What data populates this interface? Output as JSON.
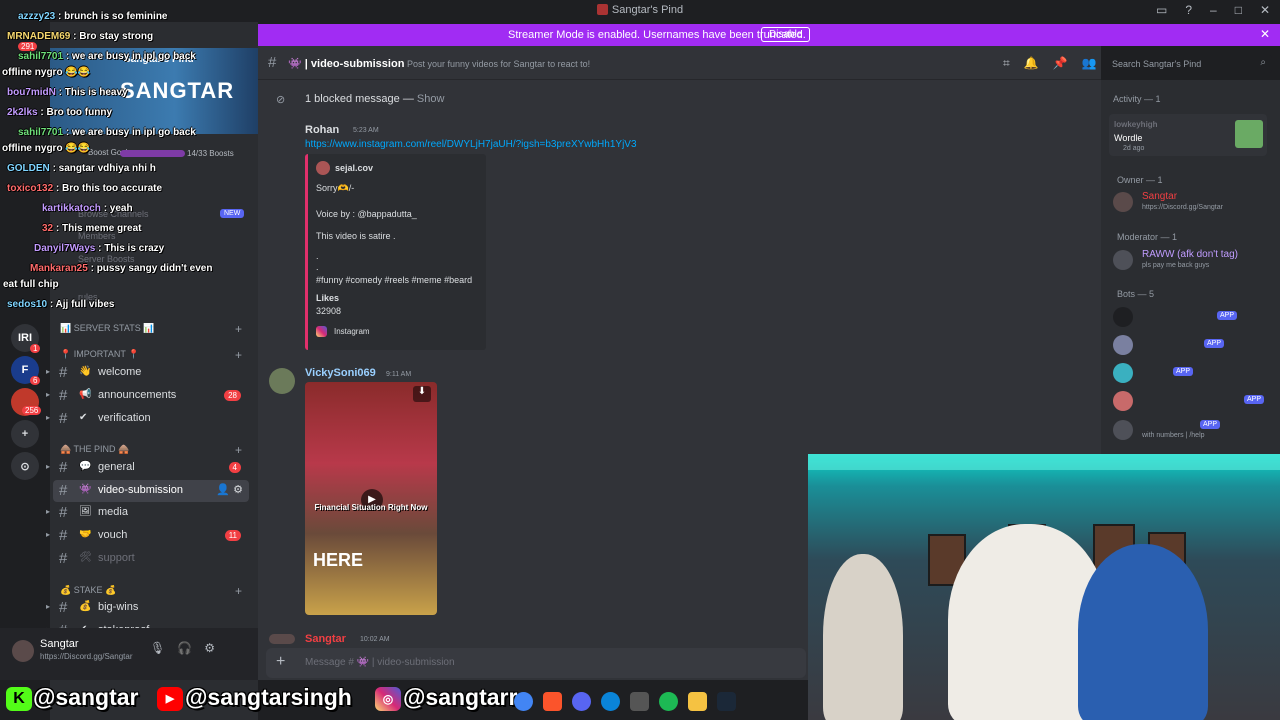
{
  "window": {
    "title": "Sangtar's Pind"
  },
  "banner": {
    "text": "Streamer Mode is enabled. Usernames have been truncated.",
    "button": "Disable"
  },
  "rail": {
    "items": [
      {
        "label": "IRI",
        "badge": "1"
      },
      {
        "label": "F",
        "badge": "6"
      },
      {
        "label": "",
        "badge": "256"
      },
      {
        "label": "+",
        "badge": ""
      },
      {
        "label": "⊙",
        "badge": ""
      }
    ],
    "top_badge": "291"
  },
  "server": {
    "name": "Sangtar's Pind",
    "banner_text": "SANGTAR",
    "boost_label": "Boost Goal",
    "boost_count": "14/33 Boosts",
    "dim_items": [
      "Browse Channels",
      "Members",
      "Server Boosts",
      "rules"
    ],
    "new_badge": "NEW"
  },
  "categories": [
    {
      "label": "📊 SERVER STATS 📊"
    },
    {
      "label": "📍 IMPORTANT 📍"
    },
    {
      "label": "🛖 The Pind 🛖"
    },
    {
      "label": "💰 Stake 💰"
    }
  ],
  "channels": [
    {
      "emoji": "👋",
      "name": "welcome",
      "count": ""
    },
    {
      "emoji": "📢",
      "name": "announcements",
      "count": "28"
    },
    {
      "emoji": "✔",
      "name": "verification",
      "count": ""
    },
    {
      "emoji": "💬",
      "name": "general",
      "count": "4"
    },
    {
      "emoji": "👾",
      "name": "video-submission",
      "count": ""
    },
    {
      "emoji": "🖼",
      "name": "media",
      "count": ""
    },
    {
      "emoji": "🤝",
      "name": "vouch",
      "count": "11"
    },
    {
      "emoji": "🛠",
      "name": "support",
      "count": ""
    },
    {
      "emoji": "💰",
      "name": "big-wins",
      "count": ""
    },
    {
      "emoji": "✔",
      "name": "stakeproof",
      "count": ""
    }
  ],
  "user": {
    "name": "Sangtar",
    "status": "https://Discord.gg/Sangtar"
  },
  "overlay_chat": [
    {
      "user": "azzzy23",
      "text": ": brunch is so feminine"
    },
    {
      "user": "MRNADEM69",
      "text": ": Bro stay strong"
    },
    {
      "user": "sahil7701",
      "text": ": we are busy in ipl go back"
    },
    {
      "user": "",
      "text": "offline nygro 😂😂"
    },
    {
      "user": "bou7midN",
      "text": ": This is heavy"
    },
    {
      "user": "2k2lks",
      "text": ": Bro too funny"
    },
    {
      "user": "sahil7701",
      "text": ": we are busy in ipl go back"
    },
    {
      "user": "",
      "text": "offline nygro 😂😂"
    },
    {
      "user": "GOLDEN",
      "text": ": sangtar vdhiya nhi h"
    },
    {
      "user": "toxico132",
      "text": ": Bro this too accurate"
    },
    {
      "user": "kartikkatoch",
      "text": ": yeah"
    },
    {
      "user": "32",
      "text": ": This meme great"
    },
    {
      "user": "Danyil7Ways",
      "text": ": This is crazy"
    },
    {
      "user": "Mankaran25",
      "text": ": pussy sangy didn't even"
    },
    {
      "user": "",
      "text": "eat full chip"
    },
    {
      "user": "sedos10",
      "text": ": Ajj full vibes"
    }
  ],
  "header": {
    "channel": "video-submission",
    "topic": "Post your funny videos for Sangtar to react to!",
    "search_placeholder": "Search Sangtar's Pind"
  },
  "messages": {
    "blocked": "1 blocked message —",
    "blocked_show": "Show",
    "m1": {
      "author": "Rohan",
      "time": "5:23 AM",
      "link": "https://www.instagram.com/reel/DWYLjH7jaUH/?igsh=b3preXYwbHh1YjV3",
      "embed": {
        "author": "sejal.cov",
        "line1": "Sorry🫶/-",
        "line2": "Voice by : @bappadutta_",
        "line3": "This video is satire .",
        "line4": ".",
        "line5": ".",
        "tags": "#funny #comedy #reels #meme #beard",
        "likes_label": "Likes",
        "likes": "32908",
        "footer": "Instagram"
      }
    },
    "m2": {
      "author": "VickySoni069",
      "time": "9:11 AM",
      "video_caption": "Financial Situation Right Now",
      "video_big": "HERE"
    },
    "m3": {
      "author": "Sangtar",
      "time": "10:02 AM"
    },
    "composer_placeholder": "Message # 👾 | video-submission"
  },
  "member_list": {
    "activity": "Activity — 1",
    "activity_card": {
      "user": "lowkeyhigh",
      "game": "Wordle",
      "ago": "2d ago"
    },
    "owner_header": "Owner — 1",
    "owner": {
      "name": "Sangtar",
      "sub": "https://Discord.gg/Sangtar"
    },
    "mod_header": "Moderator — 1",
    "mod": {
      "name": "RAWW (afk don't tag)",
      "sub": "pls pay me back guys"
    },
    "bots_header": "Bots — 5",
    "bots": [
      {
        "name": "",
        "sub": "",
        "badge": "APP"
      },
      {
        "name": "",
        "sub": "",
        "badge": "APP"
      },
      {
        "name": "",
        "sub": "",
        "badge": "APP"
      },
      {
        "name": "",
        "sub": "",
        "badge": "APP"
      },
      {
        "name": "",
        "sub": "with numbers | /help",
        "badge": "APP"
      }
    ]
  },
  "social": {
    "kick": "@sangtar",
    "youtube": "@sangtarsingh",
    "instagram": "@sangtarr"
  },
  "colors": {
    "accent": "#5865f2",
    "banner": "#a12cf3",
    "owner": "#f23f43",
    "mod": "#c09cff",
    "link": "#00a8fc"
  }
}
